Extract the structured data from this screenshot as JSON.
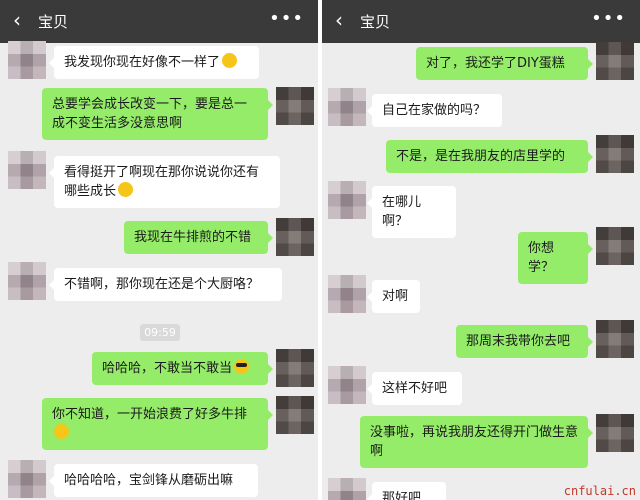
{
  "left": {
    "title": "宝贝",
    "back_icon": "chevron-left-icon",
    "more_icon": "more-icon",
    "time": "09:59",
    "messages": [
      {
        "side": "left",
        "text": "我发现你现在好像不一样了",
        "emoji": "smile-emoji"
      },
      {
        "side": "right",
        "text": "总要学会成长改变一下，要是总一成不变生活多没意思啊"
      },
      {
        "side": "left",
        "text": "看得挺开了啊现在那你说说你还有哪些成长",
        "emoji": "thinking-emoji"
      },
      {
        "side": "right",
        "text": "我现在牛排煎的不错"
      },
      {
        "side": "left",
        "text": "不错啊，那你现在还是个大厨咯？"
      },
      {
        "side": "right",
        "text": "哈哈哈，不敢当不敢当",
        "emoji": "sunglasses-emoji"
      },
      {
        "side": "right",
        "text": "你不知道，一开始浪费了好多牛排",
        "emoji": "sweat-emoji"
      },
      {
        "side": "left",
        "text": "哈哈哈哈，宝剑锋从磨砺出嘛"
      }
    ]
  },
  "right": {
    "title": "宝贝",
    "back_icon": "chevron-left-icon",
    "more_icon": "more-icon",
    "messages": [
      {
        "side": "right",
        "text": "对了，我还学了DIY蛋糕"
      },
      {
        "side": "left",
        "text": "自己在家做的吗？"
      },
      {
        "side": "right",
        "text": "不是，是在我朋友的店里学的"
      },
      {
        "side": "left",
        "text": "在哪儿啊？"
      },
      {
        "side": "right",
        "text": "你想学？"
      },
      {
        "side": "left",
        "text": "对啊"
      },
      {
        "side": "right",
        "text": "那周末我带你去吧"
      },
      {
        "side": "left",
        "text": "这样不好吧"
      },
      {
        "side": "right",
        "text": "没事啦，再说我朋友还得开门做生意啊"
      },
      {
        "side": "left",
        "text": "那好吧"
      }
    ]
  },
  "watermark": "cnfulai.cn",
  "colors": {
    "topbar": "#3a3a3a",
    "background": "#ededed",
    "bubble_right": "#95ec69",
    "bubble_left": "#ffffff"
  }
}
